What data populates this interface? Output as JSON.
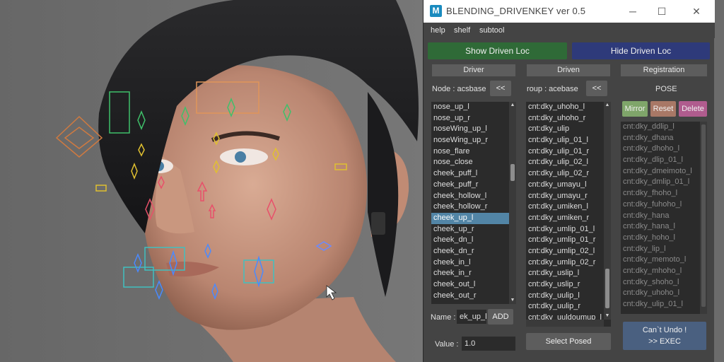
{
  "window": {
    "title": "BLENDING_DRIVENKEY  ver 0.5",
    "logo_letter": "M",
    "minimize_label": "─",
    "maximize_label": "☐",
    "close_label": "✕"
  },
  "menu": [
    "help",
    "shelf",
    "subtool"
  ],
  "buttons": {
    "show_driven_loc": "Show Driven Loc",
    "hide_driven_loc": "Hide Driven Loc"
  },
  "driver": {
    "header": "Driver",
    "node_label": "Node : acsbase",
    "back_label": "<<",
    "items": [
      "nose_up_l",
      "nose_up_r",
      "noseWing_up_l",
      "noseWing_up_r",
      "nose_flare",
      "nose_close",
      "cheek_puff_l",
      "cheek_puff_r",
      "cheek_hollow_l",
      "cheek_hollow_r",
      "cheek_up_l",
      "cheek_up_r",
      "cheek_dn_l",
      "cheek_dn_r",
      "cheek_in_l",
      "cheek_in_r",
      "cheek_out_l",
      "cheek_out_r"
    ],
    "selected": "cheek_up_l",
    "name_label": "Name :",
    "name_value": "ek_up_l",
    "add_label": "ADD",
    "value_label": "Value :",
    "value": "1.0"
  },
  "driven": {
    "header": "Driven",
    "group_label": "roup : acebase",
    "back_label": "<<",
    "items": [
      "cnt:dky_uhoho_l",
      "cnt:dky_uhoho_r",
      "cnt:dky_ulip",
      "cnt:dky_ulip_01_l",
      "cnt:dky_ulip_01_r",
      "cnt:dky_ulip_02_l",
      "cnt:dky_ulip_02_r",
      "cnt:dky_umayu_l",
      "cnt:dky_umayu_r",
      "cnt:dky_umiken_l",
      "cnt:dky_umiken_r",
      "cnt:dky_umlip_01_l",
      "cnt:dky_umlip_01_r",
      "cnt:dky_umlip_02_l",
      "cnt:dky_umlip_02_r",
      "cnt:dky_uslip_l",
      "cnt:dky_uslip_r",
      "cnt:dky_uulip_l",
      "cnt:dky_uulip_r",
      "cnt:dky_uuldoumup_l"
    ],
    "select_posed_label": "Select Posed"
  },
  "registration": {
    "header": "Registration",
    "pose_label": "POSE",
    "mirror_label": "Mirror",
    "reset_label": "Reset",
    "delete_label": "Delete",
    "items": [
      "cnt:dky_ddlip_l",
      "cnt:dky_dhana",
      "cnt:dky_dhoho_l",
      "cnt:dky_dlip_01_l",
      "cnt:dky_dmeimoto_l",
      "cnt:dky_dmlip_01_l",
      "cnt:dky_fhoho_l",
      "cnt:dky_fuhoho_l",
      "cnt:dky_hana",
      "cnt:dky_hana_l",
      "cnt:dky_hoho_l",
      "cnt:dky_lip_l",
      "cnt:dky_memoto_l",
      "cnt:dky_mhoho_l",
      "cnt:dky_shoho_l",
      "cnt:dky_uhoho_l",
      "cnt:dky_ulip_01_l"
    ],
    "exec_line1": "Can`t Undo !",
    "exec_line2": ">> EXEC"
  },
  "colors": {
    "show_btn": "#2f6a37",
    "hide_btn": "#2e3a7a",
    "mirror_btn": "#7fa56a",
    "reset_btn": "#a87866",
    "delete_btn": "#b05c8e",
    "exec_btn": "#4a6080"
  }
}
